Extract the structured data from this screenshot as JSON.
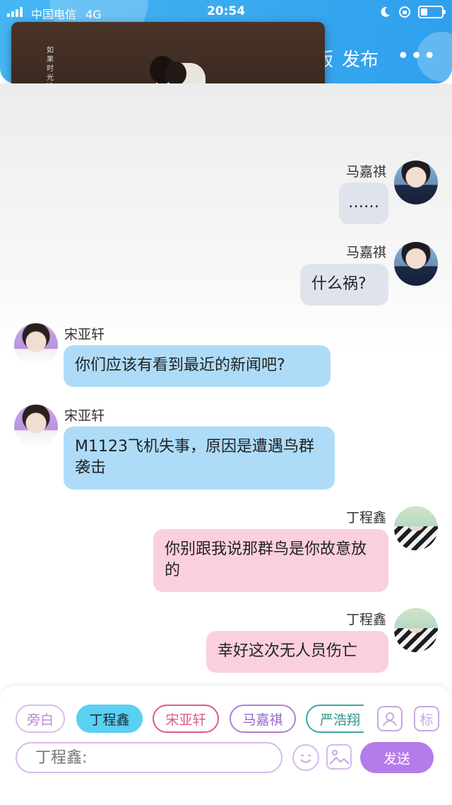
{
  "status_bar": {
    "carrier": "中国电信",
    "network": "4G",
    "time": "20:54"
  },
  "header": {
    "partial_label": "版",
    "publish_label": "发布",
    "more_label": "•••"
  },
  "video": {
    "overlay_text": "如果时光没有融化"
  },
  "messages": [
    {
      "speaker": "马嘉祺",
      "text": "……",
      "side": "right",
      "color": "#dfe4ec"
    },
    {
      "speaker": "马嘉祺",
      "text": "什么祸?",
      "side": "right",
      "color": "#dfe4ec"
    },
    {
      "speaker": "宋亚轩",
      "text": "你们应该有看到最近的新闻吧?",
      "side": "left",
      "color": "#aedcf8"
    },
    {
      "speaker": "宋亚轩",
      "text": "M1123飞机失事，原因是遭遇鸟群袭击",
      "side": "left",
      "color": "#aedcf8"
    },
    {
      "speaker": "丁程鑫",
      "text": "你别跟我说那群鸟是你故意放的",
      "side": "right",
      "color": "#fad0dc"
    },
    {
      "speaker": "丁程鑫",
      "text": "幸好这次无人员伤亡",
      "side": "right",
      "color": "#fad0dc"
    }
  ],
  "roles": [
    {
      "label": "旁白",
      "selected": false
    },
    {
      "label": "丁程鑫",
      "selected": true
    },
    {
      "label": "宋亚轩",
      "selected": false
    },
    {
      "label": "马嘉祺",
      "selected": false
    },
    {
      "label": "严浩翔",
      "selected": false
    }
  ],
  "toolbar": {
    "mark_label": "标",
    "input_placeholder": "丁程鑫:",
    "send_label": "发送"
  },
  "colors": {
    "header_blue": "#3aaaf0",
    "send_purple": "#b67bea",
    "selected_role": "#5ad0f2"
  }
}
